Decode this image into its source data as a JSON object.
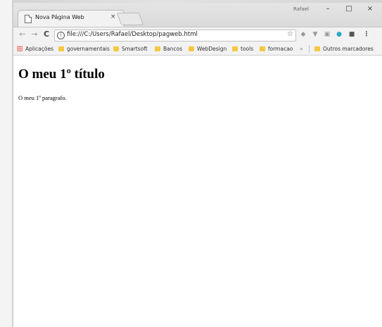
{
  "browser": {
    "tab": {
      "title": "Nova Página Web",
      "close_icon": "close-icon",
      "close_label": "×"
    },
    "profile_name": "Rafael",
    "window_controls": {
      "minimize": "–",
      "maximize": "□",
      "close": "×"
    },
    "toolbar": {
      "back": "←",
      "forward": "→",
      "reload": "C",
      "info_icon": "i",
      "url": "file:///C:/Users/Rafael/Desktop/pagweb.html",
      "star": "☆",
      "menu": "⋮"
    },
    "bookmarks": {
      "apps": "Aplicações",
      "items": [
        "governamentais",
        "Smartsoft",
        "Bancos",
        "WebDesign",
        "tools",
        "formacao"
      ],
      "overflow": "»",
      "other": "Outros marcadores"
    },
    "colors": {
      "folder": "#f4c842",
      "titlebar": "#dadada",
      "toolbar": "#f2f2f2"
    }
  },
  "page": {
    "heading": "O meu 1º título",
    "paragraph": "O meu 1º paragrafo."
  }
}
